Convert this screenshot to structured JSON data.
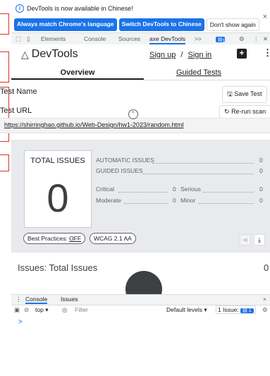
{
  "infobar": {
    "message": "DevTools is now available in Chinese!",
    "btn_match": "Always match Chrome's language",
    "btn_switch": "Switch DevTools to Chinese",
    "btn_dont": "Don't show again",
    "close": "×"
  },
  "tabs": {
    "elements": "Elements",
    "console": "Console",
    "sources": "Sources",
    "axe": "axe DevTools",
    "more": ">>",
    "msg_count": "1"
  },
  "axe": {
    "title": "DevTools",
    "signup": "Sign up",
    "slash": "/",
    "signin": "Sign in"
  },
  "subtabs": {
    "overview": "Overview",
    "guided": "Guided Tests"
  },
  "test": {
    "name_label": "Test Name",
    "save_btn": "Save Test",
    "url_label": "Test URL",
    "rerun_btn": "Re-run scan",
    "url": "https://shirringhao.github.io/Web-Design/hw1-2023/random.html"
  },
  "summary": {
    "total_title": "TOTAL ISSUES",
    "total_value": "0",
    "automatic_label": "AUTOMATIC ISSUES",
    "automatic_value": "0",
    "guided_label": "GUIDED ISSUES",
    "guided_value": "0",
    "critical_label": "Critical",
    "critical_value": "0",
    "serious_label": "Serious",
    "serious_value": "0",
    "moderate_label": "Moderate",
    "moderate_value": "0",
    "minor_label": "Minor",
    "minor_value": "0",
    "best_practices": "Best Practices: ",
    "best_practices_state": "OFF",
    "wcag": "WCAG 2.1 AA"
  },
  "issues": {
    "title": "Issues: Total Issues",
    "count": "0"
  },
  "console": {
    "tab_console": "Console",
    "tab_issues": "Issues",
    "context": "top",
    "filter_placeholder": "Filter",
    "levels": "Default levels",
    "issue_label": "1 Issue:",
    "issue_count": "1",
    "prompt": ">",
    "close": "×"
  },
  "colors": {
    "accent": "#1a73e8",
    "annotation": "#d93025"
  }
}
